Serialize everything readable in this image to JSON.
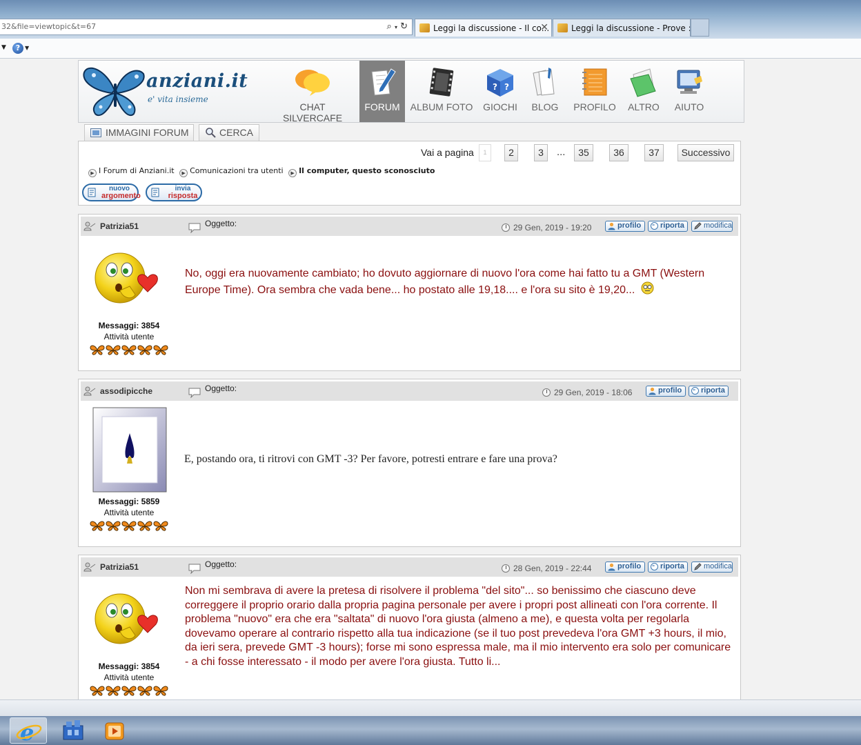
{
  "browser": {
    "address": "32&file=viewtopic&t=67",
    "tabs": [
      {
        "label": "Leggi la discussione - Il co...",
        "close": "✕"
      },
      {
        "label": "Leggi la discussione - Prove :: ..."
      }
    ],
    "help_glyph": "?"
  },
  "site": {
    "logo": "anziani.it",
    "tagline": "e' vita insieme",
    "chat": "CHAT SILVERCAFE",
    "nav": [
      {
        "label": "FORUM",
        "icon": "forum-pen-icon",
        "active": true
      },
      {
        "label": "ALBUM FOTO",
        "icon": "film-icon"
      },
      {
        "label": "GIOCHI",
        "icon": "puzzle-cube-icon"
      },
      {
        "label": "BLOG",
        "icon": "blog-pages-icon"
      },
      {
        "label": "PROFILO",
        "icon": "profile-notebook-icon"
      },
      {
        "label": "ALTRO",
        "icon": "folder-icon"
      },
      {
        "label": "AIUTO",
        "icon": "help-computer-icon"
      }
    ],
    "subtabs": [
      {
        "label": "IMMAGINI FORUM",
        "icon": "images-icon"
      },
      {
        "label": "CERCA",
        "icon": "magnifier-icon"
      }
    ]
  },
  "pagination": {
    "goto_label": "Vai a pagina",
    "current": "1",
    "pages": [
      "2",
      "3"
    ],
    "ellipsis": "...",
    "last_pages": [
      "35",
      "36",
      "37"
    ],
    "next_label": "Successivo"
  },
  "breadcrumb": [
    "I Forum di Anziani.it",
    "Comunicazioni tra utenti",
    "Il computer, questo sconosciuto"
  ],
  "actions": {
    "new_topic": [
      "nuovo",
      "argomento"
    ],
    "reply": [
      "invia",
      "risposta"
    ]
  },
  "posts": [
    {
      "user": "Patrizia51",
      "subject_label": "Oggetto:",
      "date": "29 Gen, 2019 - 19:20",
      "buttons": [
        "profilo",
        "riporta",
        "modifica"
      ],
      "messages": "Messaggi: 3854",
      "activity": "Attività utente",
      "avatar": "smiley-heart-icon",
      "body": "No, oggi era nuovamente cambiato; ho dovuto aggiornare di nuovo l'ora come hai fatto tu a GMT (Western Europe Time). Ora sembra che vada bene... ho postato alle 19,18.... e l'ora su sito è 19,20..."
    },
    {
      "user": "assodipicche",
      "subject_label": "Oggetto:",
      "date": "29 Gen, 2019 - 18:06",
      "buttons": [
        "profilo",
        "riporta"
      ],
      "messages": "Messaggi: 5859",
      "activity": "Attività utente",
      "avatar": "ace-of-spades-icon",
      "body": "E, postando ora, ti ritrovi con GMT -3? Per favore, potresti entrare e fare una prova?"
    },
    {
      "user": "Patrizia51",
      "subject_label": "Oggetto:",
      "date": "28 Gen, 2019 - 22:44",
      "buttons": [
        "profilo",
        "riporta",
        "modifica"
      ],
      "messages": "Messaggi: 3854",
      "activity": "Attività utente",
      "avatar": "smiley-heart-icon",
      "body": "Non mi sembrava di avere la pretesa di risolvere il problema \"del sito\"... so benissimo che ciascuno deve correggere il proprio orario dalla propria pagina personale per avere i propri post allineati con l'ora corrente. Il problema \"nuovo\" era che era \"saltata\" di nuovo l'ora giusta (almeno a me), e questa volta per regolarla dovevamo operare al contrario rispetto alla tua indicazione (se il tuo post prevedeva l'ora GMT +3 hours, il mio, da ieri sera, prevede GMT -3 hours); forse mi sono espressa male, ma il mio intervento era solo per comunicare - a chi fosse interessato - il modo per avere l'ora giusta. Tutto li..."
    }
  ],
  "colors": {
    "body_text": "#8a0f0f",
    "nav_active_bg": "#808080",
    "link_blue": "#2b6aa6"
  }
}
